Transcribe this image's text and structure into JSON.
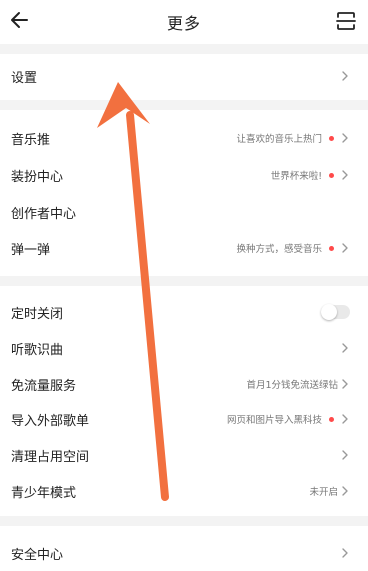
{
  "header": {
    "title": "更多"
  },
  "groups": [
    {
      "items": [
        {
          "label": "设置"
        }
      ]
    },
    {
      "items": [
        {
          "label": "音乐推",
          "sub": "让喜欢的音乐上热门",
          "dot": true
        },
        {
          "label": "装扮中心",
          "sub": "世界杯来啦!",
          "dot": true
        },
        {
          "label": "创作者中心"
        },
        {
          "label": "弹一弹",
          "sub": "换种方式，感受音乐",
          "dot": true
        }
      ]
    },
    {
      "items": [
        {
          "label": "定时关闭",
          "toggle": false
        },
        {
          "label": "听歌识曲"
        },
        {
          "label": "免流量服务",
          "sub": "首月1分钱免流送绿钻"
        },
        {
          "label": "导入外部歌单",
          "sub": "网页和图片导入黑科技",
          "dot": true
        },
        {
          "label": "清理占用空间"
        },
        {
          "label": "青少年模式",
          "sub": "未开启"
        }
      ]
    },
    {
      "items": [
        {
          "label": "安全中心"
        }
      ]
    }
  ],
  "colors": {
    "accent_dot": "#ff4a4a",
    "annotation_arrow": "#f2703f"
  },
  "icons": [
    "back-arrow-icon",
    "scan-icon",
    "chevron-right-icon"
  ]
}
